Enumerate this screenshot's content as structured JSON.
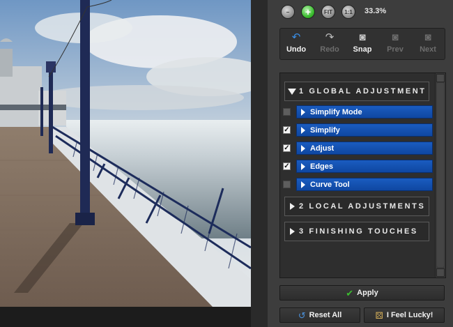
{
  "zoom": {
    "buttons": [
      {
        "name": "zoom-out-button",
        "glyph": "–"
      },
      {
        "name": "zoom-in-button",
        "glyph": "+"
      },
      {
        "name": "fit-button",
        "glyph": "FIT"
      },
      {
        "name": "actual-size-button",
        "glyph": "1:1"
      }
    ],
    "level": "33.3%"
  },
  "history": {
    "undo": {
      "label": "Undo",
      "icon": "↶"
    },
    "redo": {
      "label": "Redo",
      "icon": "↷"
    },
    "snap": {
      "label": "Snap",
      "icon": "◙"
    },
    "prev": {
      "label": "Prev",
      "icon": "◙"
    },
    "next": {
      "label": "Next",
      "icon": "◙"
    }
  },
  "sections": {
    "global": {
      "title": "1 GLOBAL ADJUSTMENT"
    },
    "local": {
      "title": "2 LOCAL ADJUSTMENTS"
    },
    "finishing": {
      "title": "3 FINISHING TOUCHES"
    }
  },
  "global_items": [
    {
      "label": "Simplify Mode",
      "checked": false
    },
    {
      "label": "Simplify",
      "checked": true
    },
    {
      "label": "Adjust",
      "checked": true
    },
    {
      "label": "Edges",
      "checked": true
    },
    {
      "label": "Curve Tool",
      "checked": false
    }
  ],
  "actions": {
    "apply": "Apply",
    "reset": "Reset All",
    "lucky": "I Feel Lucky!"
  },
  "colors": {
    "accent_blue": "#1452b3",
    "panel_bg": "#3d3d3d",
    "apply_check": "#3bbd2f"
  }
}
